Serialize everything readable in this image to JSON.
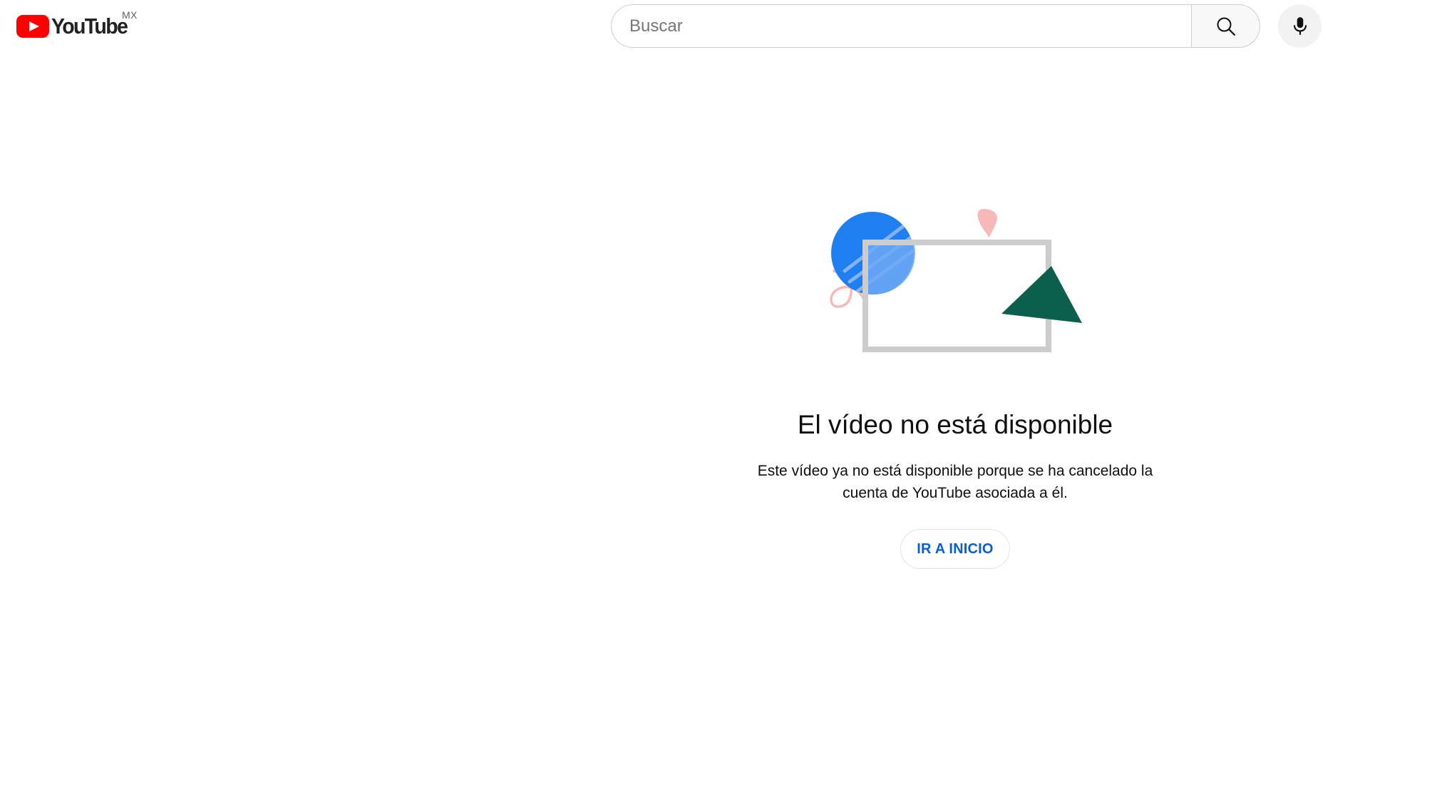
{
  "header": {
    "logo_text": "YouTube",
    "region_code": "MX",
    "search": {
      "placeholder": "Buscar",
      "value": ""
    },
    "icons": {
      "logo": "youtube-play-icon",
      "search": "search-icon",
      "voice": "microphone-icon"
    }
  },
  "error": {
    "title": "El vídeo no está disponible",
    "message": "Este vídeo ya no está disponible porque se ha cancelado la cuenta de YouTube asociada a él.",
    "button_label": "IR A INICIO",
    "illustration": "broken-video-illustration"
  },
  "colors": {
    "brand_red": "#ff0000",
    "link_blue": "#065fd4",
    "illustration_blue": "#1f7ff0",
    "illustration_green": "#0c5f4c",
    "illustration_pink": "#f7b8b8",
    "frame_gray": "#cccccc"
  }
}
